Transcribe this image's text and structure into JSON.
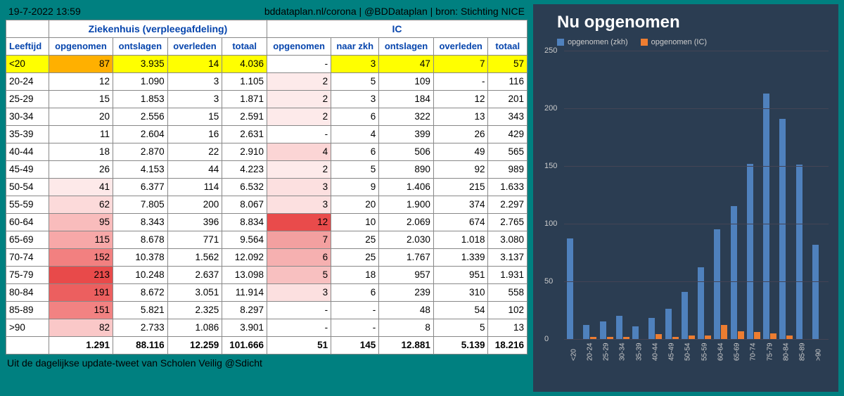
{
  "header": {
    "date": "19-7-2022 13:59",
    "source": "bddataplan.nl/corona | @BDDataplan | bron: Stichting NICE"
  },
  "footer": "Uit de dagelijkse update-tweet van Scholen Veilig @Sdicht",
  "table": {
    "group1": "Ziekenhuis (verpleegafdeling)",
    "group2": "IC",
    "cols": [
      "Leeftijd",
      "opgenomen",
      "ontslagen",
      "overleden",
      "totaal",
      "opgenomen",
      "naar zkh",
      "ontslagen",
      "overleden",
      "totaal"
    ],
    "rows": [
      {
        "age": "<20",
        "zo": "87",
        "ze": "3.935",
        "zd": "14",
        "zt": "4.036",
        "io": "-",
        "in": "3",
        "ie": "47",
        "id": "7",
        "it": "57",
        "hl": "yel",
        "c_zo": "#ffb000",
        "c_io": "#ffffff"
      },
      {
        "age": "20-24",
        "zo": "12",
        "ze": "1.090",
        "zd": "3",
        "zt": "1.105",
        "io": "2",
        "in": "5",
        "ie": "109",
        "id": "-",
        "it": "116",
        "c_zo": "#fff",
        "c_io": "#fdeaea"
      },
      {
        "age": "25-29",
        "zo": "15",
        "ze": "1.853",
        "zd": "3",
        "zt": "1.871",
        "io": "2",
        "in": "3",
        "ie": "184",
        "id": "12",
        "it": "201",
        "c_zo": "#fff",
        "c_io": "#fdeaea"
      },
      {
        "age": "30-34",
        "zo": "20",
        "ze": "2.556",
        "zd": "15",
        "zt": "2.591",
        "io": "2",
        "in": "6",
        "ie": "322",
        "id": "13",
        "it": "343",
        "c_zo": "#fff",
        "c_io": "#fdeaea"
      },
      {
        "age": "35-39",
        "zo": "11",
        "ze": "2.604",
        "zd": "16",
        "zt": "2.631",
        "io": "-",
        "in": "4",
        "ie": "399",
        "id": "26",
        "it": "429",
        "c_zo": "#fff",
        "c_io": "#fff"
      },
      {
        "age": "40-44",
        "zo": "18",
        "ze": "2.870",
        "zd": "22",
        "zt": "2.910",
        "io": "4",
        "in": "6",
        "ie": "506",
        "id": "49",
        "it": "565",
        "c_zo": "#fff",
        "c_io": "#fbd5d5"
      },
      {
        "age": "45-49",
        "zo": "26",
        "ze": "4.153",
        "zd": "44",
        "zt": "4.223",
        "io": "2",
        "in": "5",
        "ie": "890",
        "id": "92",
        "it": "989",
        "c_zo": "#fff",
        "c_io": "#fdeaea"
      },
      {
        "age": "50-54",
        "zo": "41",
        "ze": "6.377",
        "zd": "114",
        "zt": "6.532",
        "io": "3",
        "in": "9",
        "ie": "1.406",
        "id": "215",
        "it": "1.633",
        "c_zo": "#fde9e9",
        "c_io": "#fce0e0"
      },
      {
        "age": "55-59",
        "zo": "62",
        "ze": "7.805",
        "zd": "200",
        "zt": "8.067",
        "io": "3",
        "in": "20",
        "ie": "1.900",
        "id": "374",
        "it": "2.297",
        "c_zo": "#fcdada",
        "c_io": "#fce0e0"
      },
      {
        "age": "60-64",
        "zo": "95",
        "ze": "8.343",
        "zd": "396",
        "zt": "8.834",
        "io": "12",
        "in": "10",
        "ie": "2.069",
        "id": "674",
        "it": "2.765",
        "c_zo": "#f9bcbc",
        "c_io": "#e94b4b"
      },
      {
        "age": "65-69",
        "zo": "115",
        "ze": "8.678",
        "zd": "771",
        "zt": "9.564",
        "io": "7",
        "in": "25",
        "ie": "2.030",
        "id": "1.018",
        "it": "3.080",
        "c_zo": "#f7a8a8",
        "c_io": "#f3a0a0"
      },
      {
        "age": "70-74",
        "zo": "152",
        "ze": "10.378",
        "zd": "1.562",
        "zt": "12.092",
        "io": "6",
        "in": "25",
        "ie": "1.767",
        "id": "1.339",
        "it": "3.137",
        "c_zo": "#f28080",
        "c_io": "#f6b0b0"
      },
      {
        "age": "75-79",
        "zo": "213",
        "ze": "10.248",
        "zd": "2.637",
        "zt": "13.098",
        "io": "5",
        "in": "18",
        "ie": "957",
        "id": "951",
        "it": "1.931",
        "c_zo": "#e84a4a",
        "c_io": "#f8c0c0"
      },
      {
        "age": "80-84",
        "zo": "191",
        "ze": "8.672",
        "zd": "3.051",
        "zt": "11.914",
        "io": "3",
        "in": "6",
        "ie": "239",
        "id": "310",
        "it": "558",
        "c_zo": "#ec5f5f",
        "c_io": "#fce0e0"
      },
      {
        "age": "85-89",
        "zo": "151",
        "ze": "5.821",
        "zd": "2.325",
        "zt": "8.297",
        "io": "-",
        "in": "-",
        "ie": "48",
        "id": "54",
        "it": "102",
        "c_zo": "#f28282",
        "c_io": "#fff"
      },
      {
        "age": ">90",
        "zo": "82",
        "ze": "2.733",
        "zd": "1.086",
        "zt": "3.901",
        "io": "-",
        "in": "-",
        "ie": "8",
        "id": "5",
        "it": "13",
        "c_zo": "#fac8c8",
        "c_io": "#fff"
      }
    ],
    "totals": {
      "age": "",
      "zo": "1.291",
      "ze": "88.116",
      "zd": "12.259",
      "zt": "101.666",
      "io": "51",
      "in": "145",
      "ie": "12.881",
      "id": "5.139",
      "it": "18.216"
    }
  },
  "chart_data": {
    "type": "bar",
    "title": "Nu opgenomen",
    "ylim": [
      0,
      250
    ],
    "yticks": [
      0,
      50,
      100,
      150,
      200,
      250
    ],
    "categories": [
      "<20",
      "20-24",
      "25-29",
      "30-34",
      "35-39",
      "40-44",
      "45-49",
      "50-54",
      "55-59",
      "60-64",
      "65-69",
      "70-74",
      "75-79",
      "80-84",
      "85-89",
      ">90"
    ],
    "series": [
      {
        "name": "opgenomen (zkh)",
        "color": "#4f81bd",
        "values": [
          87,
          12,
          15,
          20,
          11,
          18,
          26,
          41,
          62,
          95,
          115,
          152,
          213,
          191,
          151,
          82
        ]
      },
      {
        "name": "opgenomen (IC)",
        "color": "#ed7d31",
        "values": [
          0,
          2,
          2,
          2,
          0,
          4,
          2,
          3,
          3,
          12,
          7,
          6,
          5,
          3,
          0,
          0
        ]
      }
    ]
  }
}
